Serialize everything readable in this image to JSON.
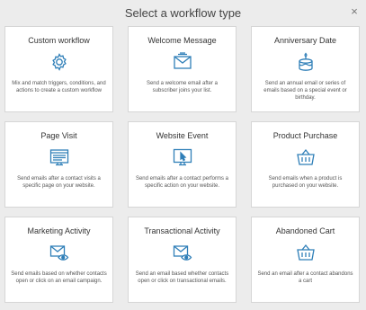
{
  "header": {
    "title": "Select a workflow type",
    "close_symbol": "×"
  },
  "accent_color": "#2f7fb8",
  "cards": [
    {
      "title": "Custom workflow",
      "icon": "gear-icon",
      "description": "Mix and match triggers, conditions, and actions to create a custom workflow"
    },
    {
      "title": "Welcome Message",
      "icon": "envelope-icon",
      "description": "Send a welcome email after a subscriber joins your list."
    },
    {
      "title": "Anniversary Date",
      "icon": "cake-icon",
      "description": "Send an annual email or series of emails based on a special event or birthday."
    },
    {
      "title": "Page Visit",
      "icon": "webpage-icon",
      "description": "Send emails after a contact visits a specific page on your website."
    },
    {
      "title": "Website Event",
      "icon": "monitor-cursor-icon",
      "description": "Send emails after a contact performs a specific action on your website."
    },
    {
      "title": "Product Purchase",
      "icon": "shopping-basket-icon",
      "description": "Send emails when a product is purchased on your website."
    },
    {
      "title": "Marketing Activity",
      "icon": "envelope-eye-icon",
      "description": "Send emails based on whether contacts open or click on an email campaign."
    },
    {
      "title": "Transactional Activity",
      "icon": "envelope-eye-icon",
      "description": "Send an email based whether contacts open or click on transactional emails."
    },
    {
      "title": "Abandoned Cart",
      "icon": "shopping-basket-icon",
      "description": "Send an email after a contact abandons a cart"
    }
  ]
}
